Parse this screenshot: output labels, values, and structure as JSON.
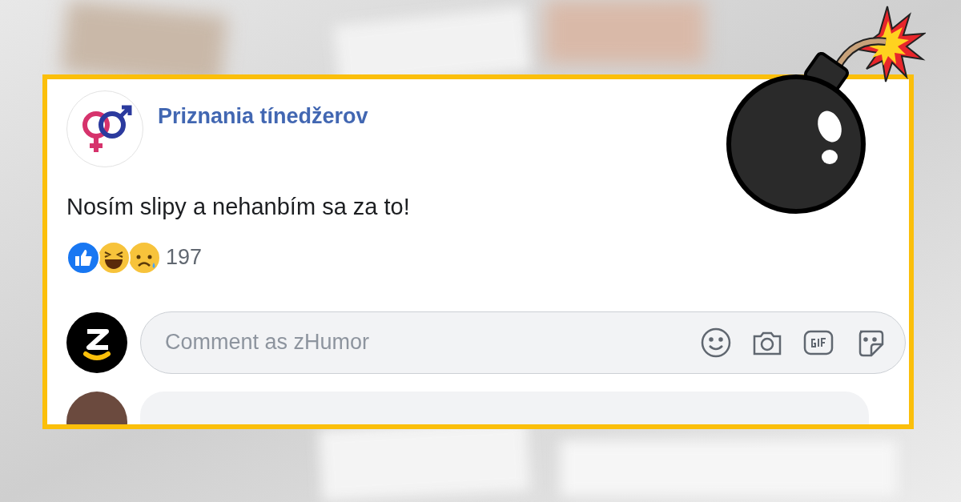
{
  "post": {
    "page_name": "Priznania tínedžerov",
    "text": "Nosím slipy a nehanbím sa za to!",
    "reaction_count": "197"
  },
  "comment_box": {
    "placeholder": "Comment as zHumor"
  }
}
